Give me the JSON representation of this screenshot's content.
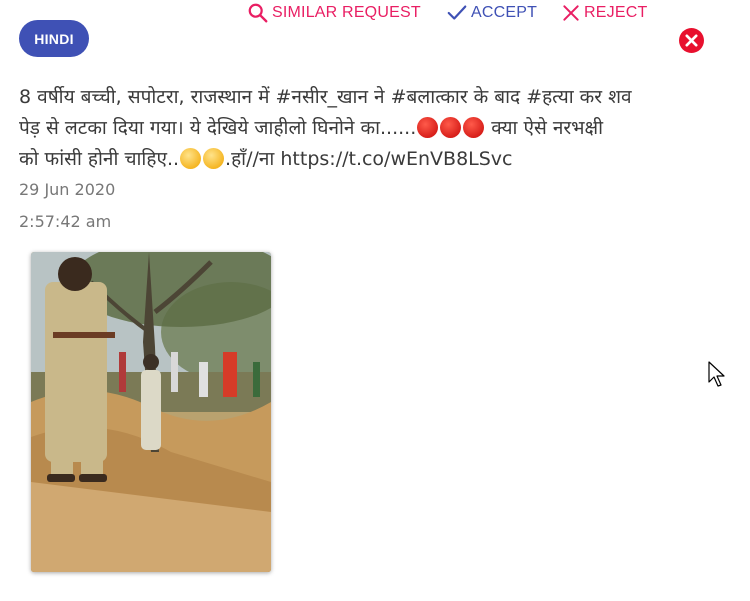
{
  "language_chip": "HINDI",
  "actions": {
    "similar_request": "SIMILAR REQUEST",
    "accept": "ACCEPT",
    "reject": "REJECT"
  },
  "tweet": {
    "line1": "8 वर्षीय बच्ची, सपोटरा, राजस्थान में #नसीर_खान ने #बलात्कार के बाद #हत्या कर शव",
    "line2_text": "पेड़ से लटका दिया गया। ये देखिये जाहीलो घिनोने का......",
    "line2_after": " क्या ऐसे नरभक्षी",
    "line3_text": "को फांसी होनी चाहिए..",
    "line3_after": ".हाँ//ना https://t.co/wEnVB8LSvc",
    "date": "29 Jun 2020",
    "time": "2:57:42 am"
  },
  "icons": {
    "similar": "search-icon",
    "accept": "check-icon",
    "reject": "x-icon",
    "close": "close-circle-icon",
    "emoji_angry": "angry-face-emoji",
    "emoji_sad": "sad-sweat-face-emoji"
  },
  "colors": {
    "chip": "#3f51b5",
    "similar": "#e91e63",
    "accept": "#3f51b5",
    "reject": "#e91e63",
    "close": "#e8102e",
    "text": "#3a3a3a",
    "meta": "#777777"
  }
}
